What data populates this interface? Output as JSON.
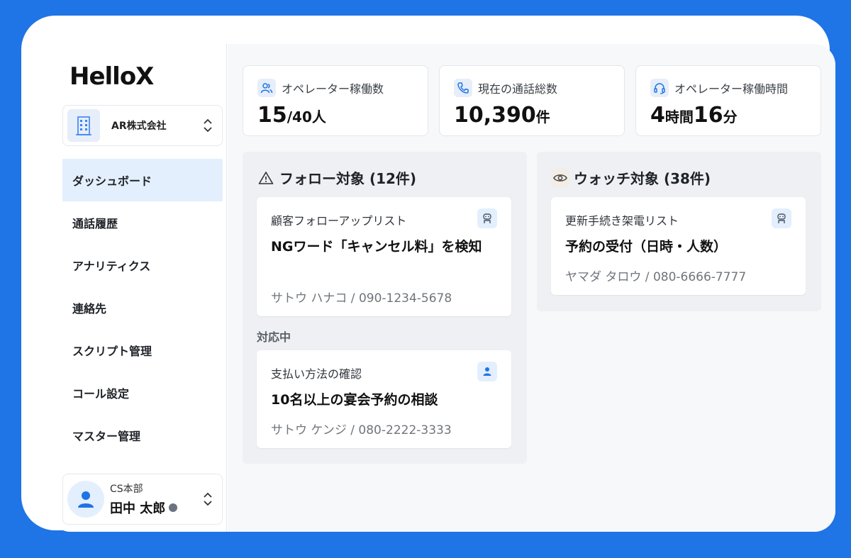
{
  "app": {
    "logo_text": "HelloX"
  },
  "company": {
    "name": "AR株式会社"
  },
  "nav": {
    "items": [
      {
        "label": "ダッシュボード",
        "active": true
      },
      {
        "label": "通話履歴"
      },
      {
        "label": "アナリティクス"
      },
      {
        "label": "連絡先"
      },
      {
        "label": "スクリプト管理"
      },
      {
        "label": "コール設定"
      },
      {
        "label": "マスター管理"
      }
    ]
  },
  "user": {
    "department": "CS本部",
    "name": "田中 太郎",
    "status_color": "#6b7280"
  },
  "stats": [
    {
      "label": "オペレーター稼働数",
      "icon": "users-icon",
      "value_parts": [
        "15",
        "/40人"
      ]
    },
    {
      "label": "現在の通話総数",
      "icon": "phone-icon",
      "value_parts": [
        "10,390",
        "件"
      ]
    },
    {
      "label": "オペレーター稼働時間",
      "icon": "headset-icon",
      "value_parts": [
        "4",
        "時間",
        "16",
        "分"
      ]
    }
  ],
  "follow_panel": {
    "title": "フォロー対象 (12件)",
    "icon": "warning-icon",
    "cards": [
      {
        "list": "顧客フォローアップリスト",
        "badge_icon": "robot-icon",
        "title": "NGワード「キャンセル料」を検知",
        "contact": "サトウ ハナコ / 090-1234-5678"
      }
    ],
    "section_label": "対応中",
    "in_progress_cards": [
      {
        "list": "支払い方法の確認",
        "badge_icon": "person-icon",
        "title": "10名以上の宴会予約の相談",
        "contact": "サトウ ケンジ / 080-2222-3333"
      }
    ]
  },
  "watch_panel": {
    "title": "ウォッチ対象 (38件)",
    "icon": "eye-icon",
    "cards": [
      {
        "list": "更新手続き架電リスト",
        "badge_icon": "robot-icon",
        "title": "予約の受付（日時・人数）",
        "contact": "ヤマダ タロウ / 080-6666-7777"
      }
    ]
  },
  "colors": {
    "accent": "#1f74e6",
    "active_nav_bg": "#e3effd",
    "panel_bg": "#eef0f3"
  }
}
